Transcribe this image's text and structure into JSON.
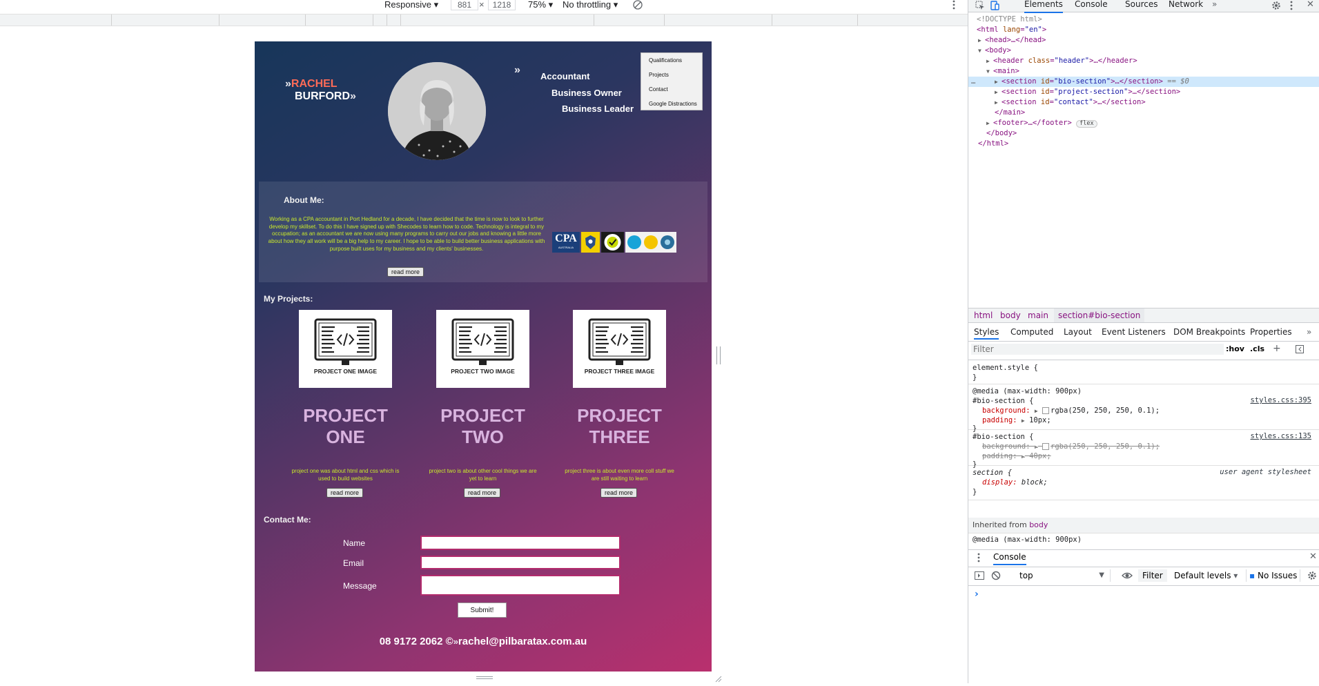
{
  "device_toolbar": {
    "mode": "Responsive",
    "width": "881",
    "times": "×",
    "height": "1218",
    "zoom": "75%",
    "throttling": "No throttling"
  },
  "site": {
    "logo_first": "RACHEL",
    "logo_last": "BURFORD",
    "roles": [
      "Accountant",
      "Business Owner",
      "Business Leader"
    ],
    "nav": [
      "Qualifications",
      "Projects",
      "Contact",
      "Google Distractions"
    ],
    "about_title": "About Me:",
    "about_text": "Working as a CPA accountant in Port Hedland for a decade, I have decided that the time is now to look to further develop my skillset. To do this I have signed up with Shecodes to learn how to code. Technology is integral to my occupation; as an accountant we are now using many programs to carry out our jobs and knowing a little more about how they all work will be a big help to my career. I hope to be able to build better business applications with purpose built uses for my business and my clients' businesses.",
    "read_more": "read more",
    "badge_cpa": "CPA",
    "badge_cpa_sub": "AUSTRALIA",
    "projects_title": "My Projects:",
    "projects": [
      {
        "img_caption": "PROJECT ONE IMAGE",
        "title": "PROJECT ONE",
        "desc": "project one was about html and css which is used to build websites",
        "button": "read more"
      },
      {
        "img_caption": "PROJECT TWO IMAGE",
        "title": "PROJECT TWO",
        "desc": "project two is about other cool things we are yet to learn",
        "button": "read more"
      },
      {
        "img_caption": "PROJECT THREE IMAGE",
        "title": "PROJECT THREE",
        "desc": "project three is about even more coll stuff we are still waiting to learn",
        "button": "read more"
      }
    ],
    "contact_title": "Contact Me:",
    "fields": {
      "name": "Name",
      "email": "Email",
      "message": "Message"
    },
    "submit": "Submit!",
    "footer_phone": "08 9172 2062 ©",
    "footer_email": "rachel@pilbaratax.com.au",
    "colors": {
      "logo_accent": "#ff6b57",
      "text_accent": "#c9e82b",
      "project_title": "#d9b4df"
    }
  },
  "devtools": {
    "tabs": [
      "Elements",
      "Console",
      "Sources",
      "Network"
    ],
    "more_tabs": "»",
    "dom": {
      "doctype": "<!DOCTYPE html>",
      "html_open": "<html",
      "lang_attr": "lang",
      "lang_val": "\"en\"",
      "head": "<head>…</head>",
      "body_open": "<body>",
      "header_tag": "<header",
      "class_attr": "class",
      "header_val": "\"header\"",
      "header_close": ">…</header>",
      "main_open": "<main>",
      "section_tag": "<section",
      "id_attr": "id",
      "bio_val": "\"bio-section\"",
      "project_val": "\"project-section\"",
      "contact_val": "\"contact\"",
      "section_close": ">…</section>",
      "selected_marker": "== $0",
      "main_close": "</main>",
      "footer": "<footer>…</footer>",
      "flex_badge": "flex",
      "body_close": "</body>",
      "html_close": "</html>"
    },
    "breadcrumbs": [
      "html",
      "body",
      "main",
      "section#bio-section"
    ],
    "style_tabs": [
      "Styles",
      "Computed",
      "Layout",
      "Event Listeners",
      "DOM Breakpoints",
      "Properties"
    ],
    "filter_placeholder": "Filter",
    "hov": ":hov",
    "cls": ".cls",
    "styles": {
      "element_style": "element.style {",
      "close_brace": "}",
      "media": "@media (max-width: 900px)",
      "bio_selector": "#bio-section {",
      "background_prop": "background:",
      "background_val": "rgba(250, 250, 250, 0.1);",
      "padding_prop": "padding:",
      "padding_10": "10px;",
      "padding_40": "40px;",
      "src_395": "styles.css:395",
      "src_135": "styles.css:135",
      "section_selector": "section {",
      "user_agent": "user agent stylesheet",
      "display_prop": "display:",
      "display_val": "block;",
      "inherited_label": "Inherited from",
      "inherited_from": "body"
    },
    "console": {
      "title": "Console",
      "context": "top",
      "filter": "Filter",
      "levels": "Default levels",
      "issues": "No Issues",
      "prompt": "›"
    }
  }
}
